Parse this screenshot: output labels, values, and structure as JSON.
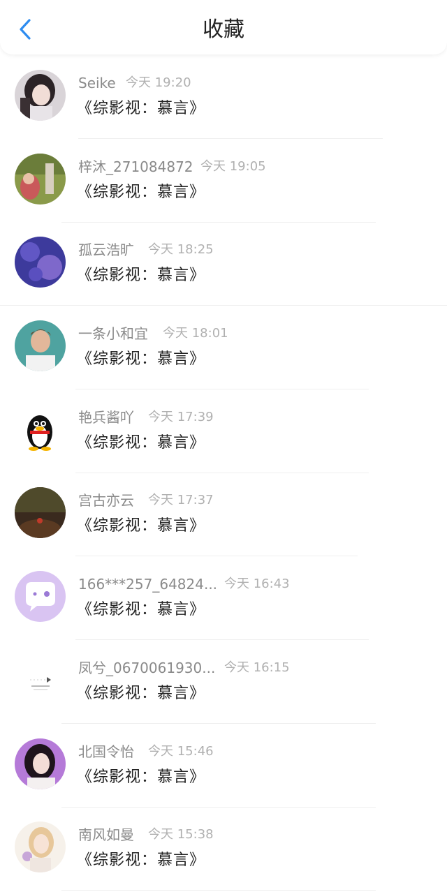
{
  "header": {
    "title": "收藏",
    "back_icon": "chevron-left-icon",
    "accent": "#2d8cf0"
  },
  "items": [
    {
      "user": "Seike",
      "time": "今天 19:20",
      "book": "《综影视：慕言》"
    },
    {
      "user": "梓沐_271084872",
      "time": "今天 19:05",
      "book": "《综影视：慕言》"
    },
    {
      "user": "孤云浩旷",
      "time": "今天 18:25",
      "book": "《综影视：慕言》"
    },
    {
      "user": "一条小和宜",
      "time": "今天 18:01",
      "book": "《综影视：慕言》"
    },
    {
      "user": "艳兵酱吖",
      "time": "今天 17:39",
      "book": "《综影视：慕言》"
    },
    {
      "user": "宫古亦云",
      "time": "今天 17:37",
      "book": "《综影视：慕言》"
    },
    {
      "user": "166***257_64824...",
      "time": "今天 16:43",
      "book": "《综影视：慕言》"
    },
    {
      "user": "凤兮_0670061930...",
      "time": "今天 16:15",
      "book": "《综影视：慕言》"
    },
    {
      "user": "北国令怡",
      "time": "今天 15:46",
      "book": "《综影视：慕言》"
    },
    {
      "user": "南风如曼",
      "time": "今天 15:38",
      "book": "《综影视：慕言》"
    }
  ]
}
